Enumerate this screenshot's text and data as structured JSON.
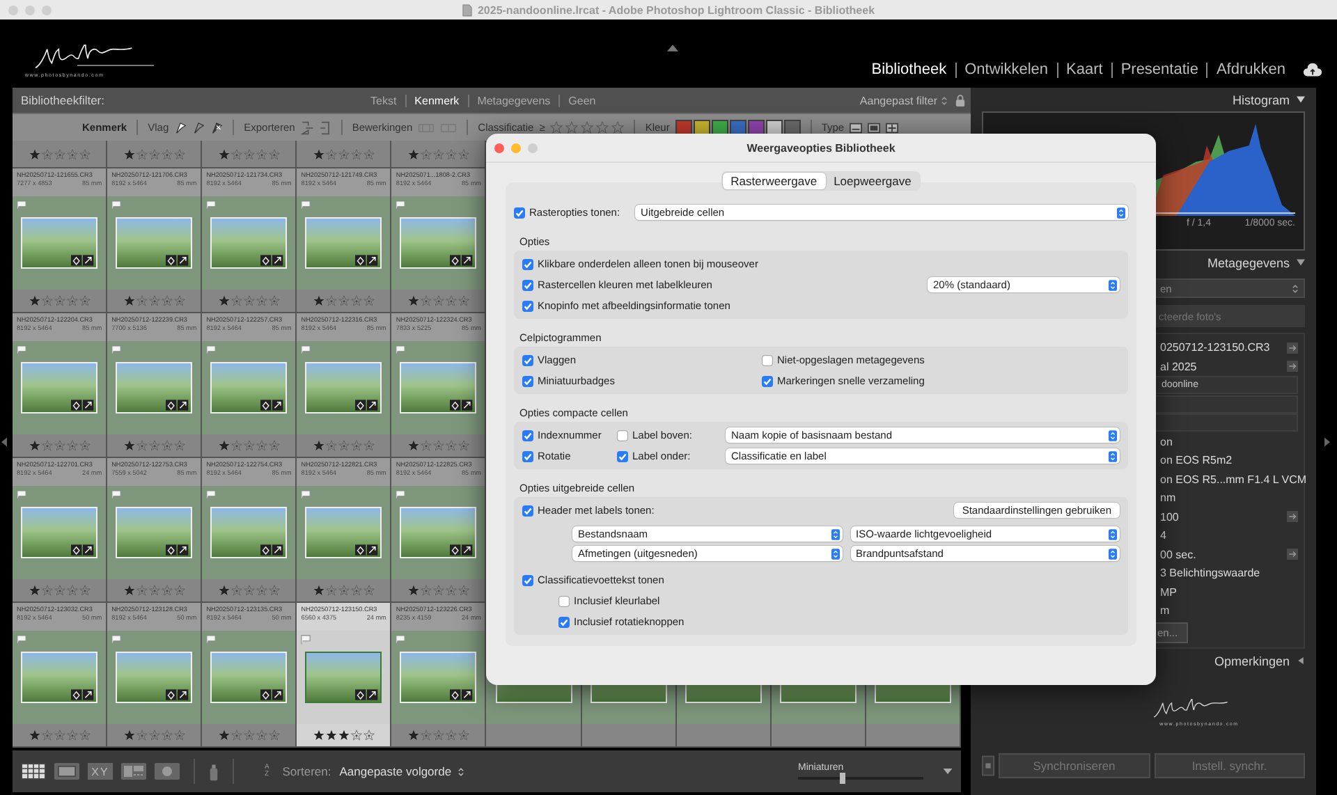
{
  "window": {
    "title": "2025-nandoonline.lrcat - Adobe Photoshop Lightroom Classic - Bibliotheek"
  },
  "identity": {
    "tagline": "www.photosbynando.com"
  },
  "modules": [
    {
      "label": "Bibliotheek",
      "selected": true
    },
    {
      "label": "Ontwikkelen",
      "selected": false
    },
    {
      "label": "Kaart",
      "selected": false
    },
    {
      "label": "Presentatie",
      "selected": false
    },
    {
      "label": "Afdrukken",
      "selected": false
    }
  ],
  "filter_bar": {
    "title": "Bibliotheekfilter:",
    "tabs": [
      {
        "label": "Tekst",
        "selected": false
      },
      {
        "label": "Kenmerk",
        "selected": true
      },
      {
        "label": "Metagegevens",
        "selected": false
      },
      {
        "label": "Geen",
        "selected": false
      }
    ],
    "preset": "Aangepast filter"
  },
  "attribute_bar": {
    "title": "Kenmerk",
    "flag_label": "Vlag",
    "export_label": "Exporteren",
    "edit_label": "Bewerkingen",
    "rating_label": "Classificatie",
    "rating_operator": "≥",
    "color_label": "Kleur",
    "type_label": "Type",
    "color_labels": [
      {
        "color": "#c0392b"
      },
      {
        "color": "#c9b52f"
      },
      {
        "color": "#3fae49"
      },
      {
        "color": "#3a6fc4"
      },
      {
        "color": "#8e44ad"
      },
      {
        "color": "#d0d0d0"
      },
      {
        "color": "#6a6a6a"
      }
    ]
  },
  "grid": {
    "top_ratings": [
      {
        "stars": 1
      },
      {
        "stars": 1
      },
      {
        "stars": 1
      },
      {
        "stars": 1
      },
      {
        "stars": 1
      }
    ],
    "rows": [
      [
        {
          "filename": "NH20250712-121655.CR3",
          "dimensions": "7277 x 4853",
          "focal_length": "85 mm",
          "stars": 1,
          "selected": false
        },
        {
          "filename": "NH20250712-121706.CR3",
          "dimensions": "8192 x 5464",
          "focal_length": "85 mm",
          "stars": 1,
          "selected": false
        },
        {
          "filename": "NH20250712-121734.CR3",
          "dimensions": "8192 x 5464",
          "focal_length": "85 mm",
          "stars": 1,
          "selected": false
        },
        {
          "filename": "NH20250712-121749.CR3",
          "dimensions": "8192 x 5464",
          "focal_length": "85 mm",
          "stars": 1,
          "selected": false
        },
        {
          "filename": "NH2025071...1808-2.CR3",
          "dimensions": "8192 x 5464",
          "focal_length": "85 mm",
          "stars": 1,
          "selected": false
        }
      ],
      [
        {
          "filename": "NH20250712-122204.CR3",
          "dimensions": "8192 x 5464",
          "focal_length": "85 mm",
          "stars": 1,
          "selected": false
        },
        {
          "filename": "NH20250712-122239.CR3",
          "dimensions": "7700 x 5136",
          "focal_length": "85 mm",
          "stars": 1,
          "selected": false
        },
        {
          "filename": "NH20250712-122257.CR3",
          "dimensions": "8192 x 5464",
          "focal_length": "85 mm",
          "stars": 1,
          "selected": false
        },
        {
          "filename": "NH20250712-122316.CR3",
          "dimensions": "8192 x 5464",
          "focal_length": "85 mm",
          "stars": 1,
          "selected": false
        },
        {
          "filename": "NH20250712-122324.CR3",
          "dimensions": "7833 x 5225",
          "focal_length": "85 mm",
          "stars": 1,
          "selected": false
        }
      ],
      [
        {
          "filename": "NH20250712-122701.CR3",
          "dimensions": "8192 x 5464",
          "focal_length": "24 mm",
          "stars": 1,
          "selected": false
        },
        {
          "filename": "NH20250712-122753.CR3",
          "dimensions": "7559 x 5042",
          "focal_length": "85 mm",
          "stars": 1,
          "selected": false
        },
        {
          "filename": "NH20250712-122754.CR3",
          "dimensions": "8192 x 5464",
          "focal_length": "85 mm",
          "stars": 1,
          "selected": false
        },
        {
          "filename": "NH20250712-122821.CR3",
          "dimensions": "8192 x 5464",
          "focal_length": "85 mm",
          "stars": 1,
          "selected": false
        },
        {
          "filename": "NH20250712-122825.CR3",
          "dimensions": "8192 x 5464",
          "focal_length": "85 mm",
          "stars": 1,
          "selected": false
        }
      ],
      [
        {
          "filename": "NH20250712-123032.CR3",
          "dimensions": "8192 x 5464",
          "focal_length": "50 mm",
          "stars": 1,
          "selected": false
        },
        {
          "filename": "NH20250712-123128.CR3",
          "dimensions": "8192 x 5464",
          "focal_length": "50 mm",
          "stars": 1,
          "selected": false
        },
        {
          "filename": "NH20250712-123135.CR3",
          "dimensions": "8192 x 5464",
          "focal_length": "50 mm",
          "stars": 1,
          "selected": false
        },
        {
          "filename": "NH20250712-123150.CR3",
          "dimensions": "6560 x 4375",
          "focal_length": "24 mm",
          "stars": 3,
          "selected": true
        },
        {
          "filename": "NH20250712-123226.CR3",
          "dimensions": "8235 x 4159",
          "focal_length": "24 mm",
          "stars": 1,
          "selected": false
        }
      ]
    ]
  },
  "toolbar": {
    "compare_glyphs": "XY",
    "sort_glyphs": "AZ",
    "sort_label": "Sorteren:",
    "sort_value": "Aangepaste volgorde",
    "thumbnail_label": "Miniaturen",
    "level": 0.35
  },
  "right_panel": {
    "histogram": {
      "title": "Histogram",
      "readings": [
        "f / 1,4",
        "1/8000 sec."
      ]
    },
    "metadata": {
      "title": "Metagegevens",
      "preset": "en",
      "target": "cteerde foto's",
      "rows": [
        {
          "kind": "text",
          "value": "0250712-123150.CR3",
          "action": true
        },
        {
          "kind": "text",
          "value": "al 2025",
          "action": true
        },
        {
          "kind": "field",
          "value": "doonline",
          "action": false
        },
        {
          "kind": "empty_field",
          "action": false
        },
        {
          "kind": "empty_field",
          "action": false
        },
        {
          "kind": "text",
          "value": "on",
          "action": false
        },
        {
          "kind": "text",
          "value": "on EOS R5m2",
          "action": false
        },
        {
          "kind": "text",
          "value": "on EOS R5...mm F1.4 L VCM",
          "action": false
        },
        {
          "kind": "text",
          "value": "nm",
          "action": false
        },
        {
          "kind": "text",
          "value": "100",
          "action": true
        },
        {
          "kind": "text",
          "value": "4",
          "action": false
        },
        {
          "kind": "text",
          "value": "00 sec.",
          "action": true
        },
        {
          "kind": "text",
          "value": "3 Belichtingswaarde",
          "action": false
        },
        {
          "kind": "text",
          "value": "MP",
          "action": false
        },
        {
          "kind": "text",
          "value": "m",
          "action": false
        },
        {
          "kind": "button",
          "value": "en..."
        }
      ]
    },
    "comments": {
      "title": "Opmerkingen"
    },
    "tagline": "www.photosbynando.com",
    "sync_button": "Synchroniseren",
    "sync_settings_button": "Instell. synchr."
  },
  "dialog": {
    "title": "Weergaveopties Bibliotheek",
    "tabs": [
      {
        "label": "Rasterweergave",
        "selected": true
      },
      {
        "label": "Loepweergave",
        "selected": false
      }
    ],
    "grid_options": {
      "label": "Rasteropties tonen:",
      "checked": true,
      "value": "Uitgebreide cellen"
    },
    "options": {
      "title": "Opties",
      "items": [
        {
          "label": "Klikbare onderdelen alleen tonen bij mouseover",
          "checked": true
        },
        {
          "label": "Rastercellen kleuren met labelkleuren",
          "checked": true,
          "select": "20% (standaard)"
        },
        {
          "label": "Knopinfo met afbeeldingsinformatie tonen",
          "checked": true
        }
      ]
    },
    "cell_icons": {
      "title": "Celpictogrammen",
      "items": [
        {
          "label": "Vlaggen",
          "checked": true
        },
        {
          "label": "Niet-opgeslagen metagegevens",
          "checked": false
        },
        {
          "label": "Miniatuurbadges",
          "checked": true
        },
        {
          "label": "Markeringen snelle verzameling",
          "checked": true
        }
      ]
    },
    "compact": {
      "title": "Opties compacte cellen",
      "rows": [
        {
          "left": {
            "label": "Indexnummer",
            "checked": true
          },
          "right": {
            "label": "Label boven:",
            "checked": false,
            "select": "Naam kopie of basisnaam bestand"
          }
        },
        {
          "left": {
            "label": "Rotatie",
            "checked": true
          },
          "right": {
            "label": "Label onder:",
            "checked": true,
            "select": "Classificatie en label"
          }
        }
      ]
    },
    "expanded": {
      "title": "Opties uitgebreide cellen",
      "header": {
        "label": "Header met labels tonen:",
        "checked": true
      },
      "defaults_button": "Standaardinstellingen gebruiken",
      "header_fields": [
        "Bestandsnaam",
        "ISO-waarde lichtgevoeligheid",
        "Afmetingen (uitgesneden)",
        "Brandpuntsafstand"
      ],
      "footer": {
        "label": "Classificatievoettekst tonen",
        "checked": true
      },
      "footer_options": [
        {
          "label": "Inclusief kleurlabel",
          "checked": false
        },
        {
          "label": "Inclusief rotatieknoppen",
          "checked": true
        }
      ]
    }
  }
}
